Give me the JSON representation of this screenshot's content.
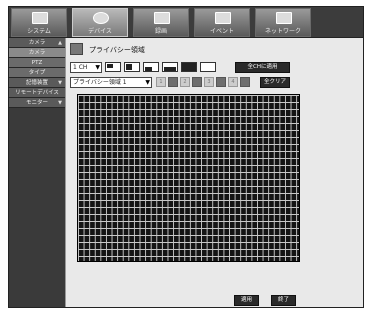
{
  "tabs": [
    {
      "label": "システム",
      "icon": "monitor-icon"
    },
    {
      "label": "デバイス",
      "icon": "camera-icon"
    },
    {
      "label": "録画",
      "icon": "recorder-icon"
    },
    {
      "label": "イベント",
      "icon": "event-icon"
    },
    {
      "label": "ネットワーク",
      "icon": "network-icon"
    }
  ],
  "sidebar": {
    "items": [
      {
        "label": "カメラ",
        "kind": "group"
      },
      {
        "label": "カメラ",
        "kind": "sub"
      },
      {
        "label": "PTZ",
        "kind": "sub"
      },
      {
        "label": "タイプ",
        "kind": "sub"
      },
      {
        "label": "記憶装置",
        "kind": "group"
      },
      {
        "label": "リモートデバイス",
        "kind": "group"
      },
      {
        "label": "モニター",
        "kind": "group"
      }
    ]
  },
  "page": {
    "title": "プライバシー領域",
    "channel_value": "1 CH",
    "area_value": "プライバシー領域 1",
    "area_numbers": [
      "1",
      "2",
      "3",
      "4"
    ],
    "apply_all_label": "全CHに適用",
    "clear_all_label": "全クリア",
    "apply_label": "適用",
    "close_label": "終了"
  }
}
